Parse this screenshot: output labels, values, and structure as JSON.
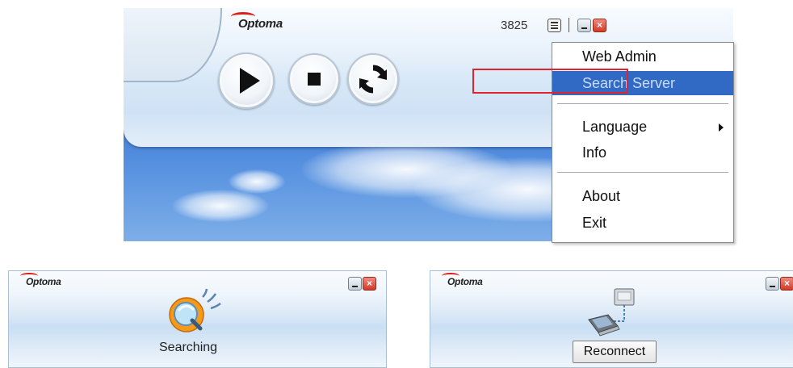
{
  "main_window": {
    "brand": "Optoma",
    "ip_suffix": "3825",
    "controls": {
      "play": "play-icon",
      "stop": "stop-icon",
      "refresh": "refresh-icon"
    },
    "close_glyph": "×"
  },
  "context_menu": {
    "items": [
      {
        "label": "Web Admin"
      },
      {
        "label": "Search Server",
        "selected": true
      },
      {
        "label": "Language",
        "has_submenu": true
      },
      {
        "label": "Info"
      },
      {
        "label": "About"
      },
      {
        "label": "Exit"
      }
    ]
  },
  "searching_window": {
    "brand": "Optoma",
    "status": "Searching",
    "close_glyph": "×"
  },
  "reconnect_window": {
    "brand": "Optoma",
    "button_label": "Reconnect",
    "close_glyph": "×"
  },
  "colors": {
    "brand_red": "#d8201c",
    "menu_selection": "#316ac5",
    "annotation_box": "#e0242e"
  }
}
